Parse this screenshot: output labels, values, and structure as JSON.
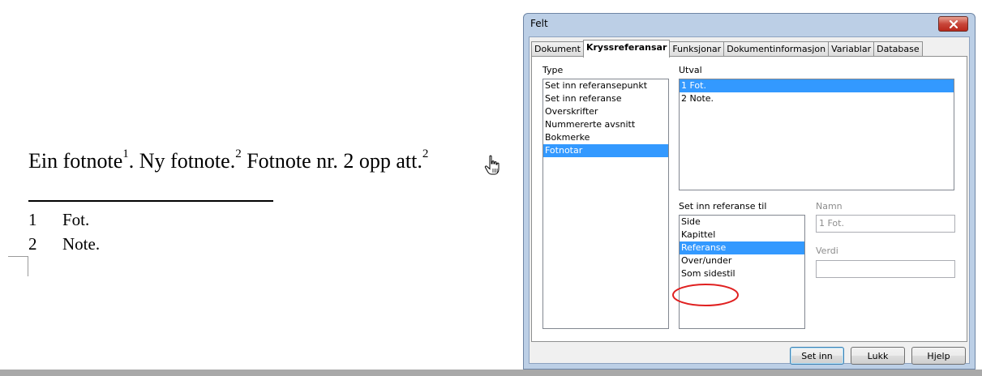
{
  "document": {
    "sentence": {
      "part1": "Ein fotnote",
      "sup1": "1",
      "part2": ". Ny fotnote.",
      "sup2": "2",
      "part3": " Fotnote nr. 2 opp att.",
      "sup3": "2"
    },
    "footnotes": [
      {
        "num": "1",
        "text": "Fot."
      },
      {
        "num": "2",
        "text": "Note."
      }
    ]
  },
  "dialog": {
    "title": "Felt",
    "tabs": [
      "Dokument",
      "Kryssreferansar",
      "Funksjonar",
      "Dokumentinformasjon",
      "Variablar",
      "Database"
    ],
    "active_tab": "Kryssreferansar",
    "type_label": "Type",
    "type_items": [
      "Set inn referansepunkt",
      "Set inn referanse",
      "Overskrifter",
      "Nummererte avsnitt",
      "Bokmerke",
      "Fotnotar"
    ],
    "type_selected": "Fotnotar",
    "utval_label": "Utval",
    "utval_items": [
      "1 Fot.",
      "2 Note."
    ],
    "utval_selected": "1 Fot.",
    "insert_ref_label": "Set inn referanse til",
    "insert_ref_items": [
      "Side",
      "Kapittel",
      "Referanse",
      "Over/under",
      "Som sidestil"
    ],
    "insert_ref_selected": "Referanse",
    "namn_label": "Namn",
    "namn_value": "1 Fot.",
    "verdi_label": "Verdi",
    "verdi_value": "",
    "buttons": {
      "insert": "Set inn",
      "close": "Lukk",
      "help": "Hjelp"
    },
    "highlight_color": "#3399ff",
    "annotation_color": "#e02020"
  }
}
